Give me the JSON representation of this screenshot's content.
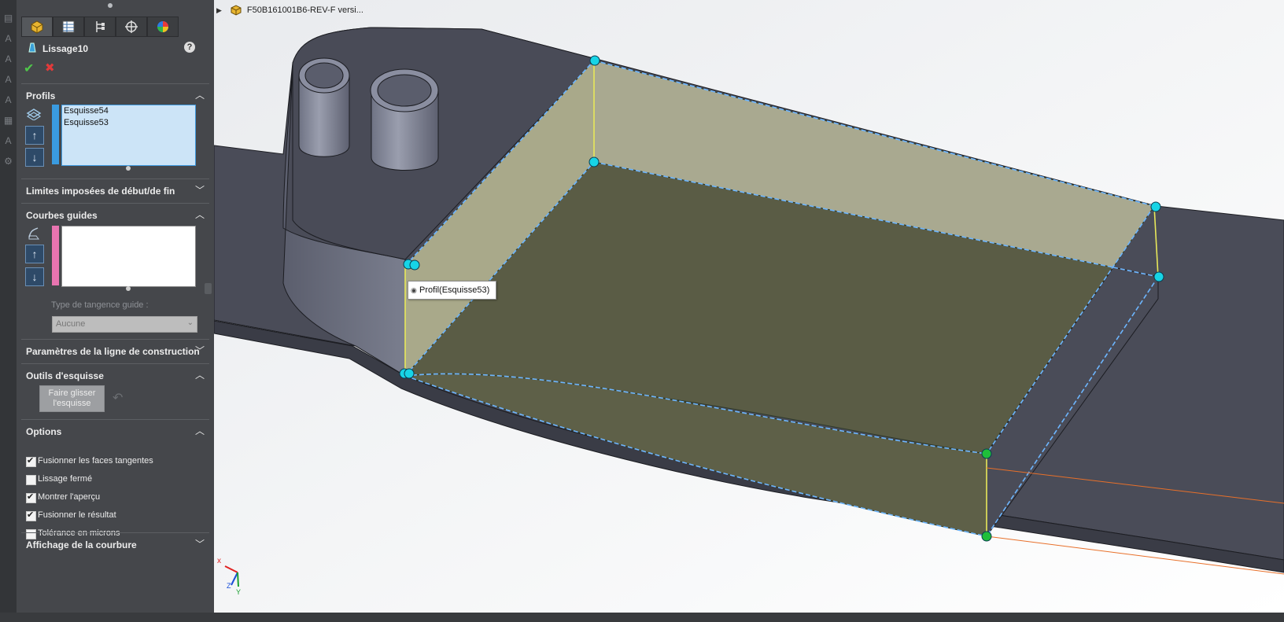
{
  "feature": {
    "name": "Lissage10",
    "help": "?"
  },
  "confirm": {
    "ok": "✔",
    "cancel": "✖"
  },
  "tabs": [
    "feature-manager",
    "property-manager",
    "configuration-manager",
    "dimxpert-manager",
    "display-manager"
  ],
  "sections": {
    "profils": {
      "title": "Profils",
      "items": [
        "Esquisse54",
        "Esquisse53"
      ],
      "expanded": true
    },
    "limites": {
      "title": "Limites imposées de début/de fin",
      "expanded": false
    },
    "courbes": {
      "title": "Courbes guides",
      "expanded": true,
      "tangence_label": "Type de tangence guide :",
      "tangence_value": "Aucune"
    },
    "ligne": {
      "title": "Paramètres de la ligne de construction",
      "expanded": false
    },
    "outils": {
      "title": "Outils d'esquisse",
      "expanded": true,
      "drag_button": "Faire glisser l'esquisse",
      "drag_button_line1": "Faire glisser",
      "drag_button_line2": "l'esquisse"
    },
    "options": {
      "title": "Options",
      "expanded": true,
      "checkboxes": [
        {
          "label": "Fusionner les faces tangentes",
          "checked": true
        },
        {
          "label": "Lissage fermé",
          "checked": false
        },
        {
          "label": "Montrer l'aperçu",
          "checked": true
        },
        {
          "label": "Fusionner le résultat",
          "checked": true
        },
        {
          "label": "Tolérance en microns",
          "checked": false
        }
      ]
    },
    "courbure": {
      "title": "Affichage de la courbure",
      "expanded": false
    }
  },
  "breadcrumb": {
    "label": "F50B161001B6-REV-F versi..."
  },
  "tooltip": {
    "label": "Profil(Esquisse53)"
  },
  "triad": {
    "x": "x",
    "y": "Y",
    "z": "Z"
  },
  "colors": {
    "panel_bg": "#45474b",
    "selection_blue": "#3f9ae0",
    "guide_pink": "#e874b0",
    "preview_fill": "#c8c896",
    "point_cyan": "#17d4e6",
    "point_green": "#1fbf3a"
  }
}
